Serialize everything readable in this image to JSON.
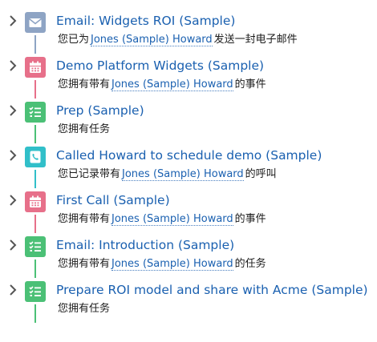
{
  "colors": {
    "email": "#8ea4c4",
    "event": "#e7708a",
    "task": "#4bc076",
    "call": "#31bfc9",
    "link": "#1a60b0"
  },
  "activities": [
    {
      "type": "email",
      "icon": "envelope-icon",
      "title": "Email: Widgets ROI (Sample)",
      "prefix": "您已为",
      "contact": "Jones (Sample) Howard",
      "suffix": "发送一封电子邮件"
    },
    {
      "type": "event",
      "icon": "calendar-icon",
      "title": "Demo Platform Widgets (Sample)",
      "prefix": "您拥有带有",
      "contact": "Jones (Sample) Howard",
      "suffix": "的事件"
    },
    {
      "type": "task",
      "icon": "task-checklist-icon",
      "title": "Prep (Sample)",
      "prefix": "您拥有任务",
      "contact": "",
      "suffix": ""
    },
    {
      "type": "call",
      "icon": "phone-icon",
      "title": "Called Howard to schedule demo (Sample)",
      "prefix": "您已记录带有",
      "contact": "Jones (Sample) Howard",
      "suffix": "的呼叫"
    },
    {
      "type": "event",
      "icon": "calendar-icon",
      "title": "First Call (Sample)",
      "prefix": "您拥有带有",
      "contact": "Jones (Sample) Howard",
      "suffix": "的事件"
    },
    {
      "type": "task",
      "icon": "task-checklist-icon",
      "title": "Email: Introduction (Sample)",
      "prefix": "您拥有带有",
      "contact": "Jones (Sample) Howard",
      "suffix": "的任务"
    },
    {
      "type": "task",
      "icon": "task-checklist-icon",
      "title": "Prepare ROI model and share with Acme (Sample)",
      "prefix": "您拥有任务",
      "contact": "",
      "suffix": ""
    }
  ]
}
